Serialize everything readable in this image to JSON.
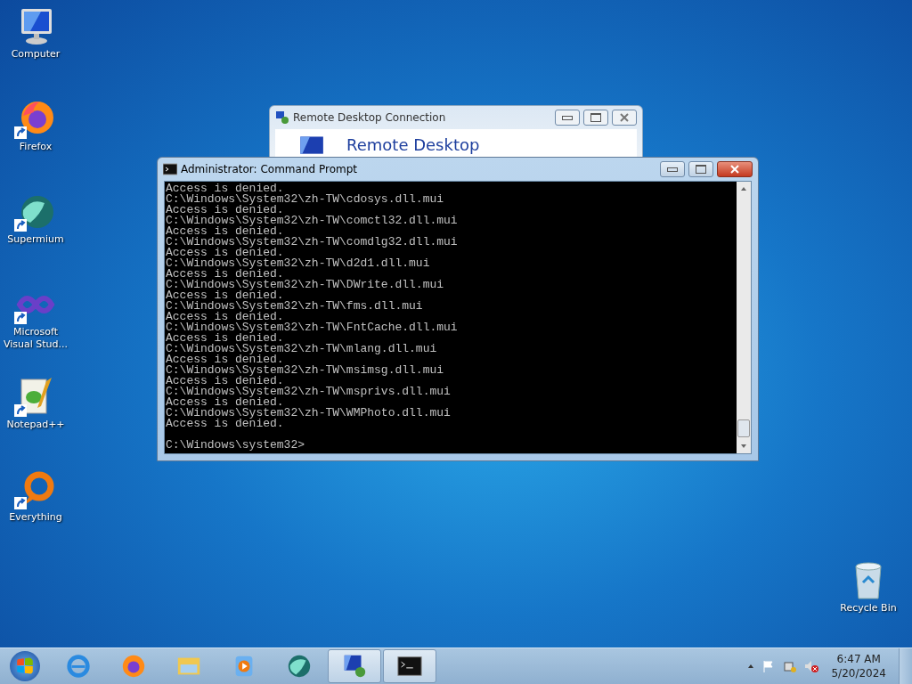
{
  "desktop_icons": [
    {
      "label": "Computer",
      "kind": "computer",
      "shortcut": false
    },
    {
      "label": "Firefox",
      "kind": "firefox",
      "shortcut": true
    },
    {
      "label": "Supermium",
      "kind": "globe",
      "shortcut": true
    },
    {
      "label": "Microsoft Visual Stud...",
      "kind": "infinity",
      "shortcut": true
    },
    {
      "label": "Notepad++",
      "kind": "notepad",
      "shortcut": true
    },
    {
      "label": "Everything",
      "kind": "ring",
      "shortcut": true
    }
  ],
  "recycle_bin": {
    "label": "Recycle Bin"
  },
  "background_window": {
    "title": "Remote Desktop Connection",
    "heading": "Remote Desktop"
  },
  "console_window": {
    "title": "Administrator: Command Prompt",
    "lines": [
      "Access is denied.",
      "C:\\Windows\\System32\\zh-TW\\cdosys.dll.mui",
      "Access is denied.",
      "C:\\Windows\\System32\\zh-TW\\comctl32.dll.mui",
      "Access is denied.",
      "C:\\Windows\\System32\\zh-TW\\comdlg32.dll.mui",
      "Access is denied.",
      "C:\\Windows\\System32\\zh-TW\\d2d1.dll.mui",
      "Access is denied.",
      "C:\\Windows\\System32\\zh-TW\\DWrite.dll.mui",
      "Access is denied.",
      "C:\\Windows\\System32\\zh-TW\\fms.dll.mui",
      "Access is denied.",
      "C:\\Windows\\System32\\zh-TW\\FntCache.dll.mui",
      "Access is denied.",
      "C:\\Windows\\System32\\zh-TW\\mlang.dll.mui",
      "Access is denied.",
      "C:\\Windows\\System32\\zh-TW\\msimsg.dll.mui",
      "Access is denied.",
      "C:\\Windows\\System32\\zh-TW\\msprivs.dll.mui",
      "Access is denied.",
      "C:\\Windows\\System32\\zh-TW\\WMPhoto.dll.mui",
      "Access is denied."
    ],
    "prompt": "C:\\Windows\\system32>"
  },
  "taskbar": {
    "items": [
      {
        "kind": "ie",
        "open": false
      },
      {
        "kind": "firefox",
        "open": false
      },
      {
        "kind": "folder",
        "open": false
      },
      {
        "kind": "media",
        "open": false
      },
      {
        "kind": "globe",
        "open": false
      },
      {
        "kind": "remote",
        "open": true
      },
      {
        "kind": "console",
        "open": true
      }
    ],
    "tray": {
      "time": "6:47 AM",
      "date": "5/20/2024"
    }
  }
}
